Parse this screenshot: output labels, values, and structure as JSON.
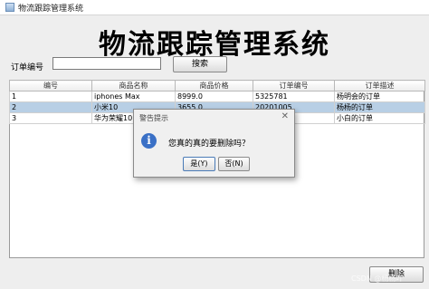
{
  "window": {
    "title": "物流跟踪管理系统"
  },
  "heading": "物流跟踪管理系统",
  "search": {
    "label": "订单编号",
    "value": "",
    "button_label": "搜索"
  },
  "table": {
    "columns": [
      "编号",
      "商品名称",
      "商品价格",
      "订单编号",
      "订单描述"
    ],
    "rows": [
      [
        "1",
        "iphones Max",
        "8999.0",
        "5325781",
        "杨明会的订单"
      ],
      [
        "2",
        "小米10",
        "3655.0",
        "20201005",
        "杨杨的订单"
      ],
      [
        "3",
        "华为荣耀10",
        "",
        "",
        "小白的订单"
      ]
    ],
    "selected_row": 2
  },
  "dialog": {
    "title": "警告提示",
    "message": "您真的真的要删除吗？",
    "yes_label": "是(Y)",
    "no_label": "否(N)",
    "icon": "info-icon"
  },
  "footer": {
    "delete_label": "删除"
  },
  "watermark": "CSDN @杨杨吖"
}
